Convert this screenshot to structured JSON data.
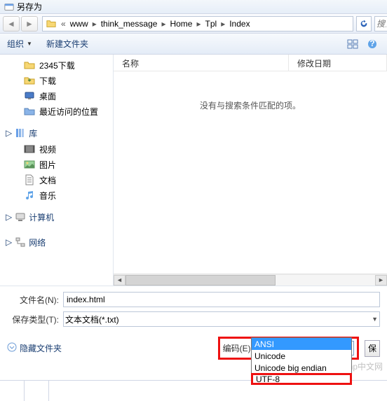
{
  "title": "另存为",
  "breadcrumb": [
    "www",
    "think_message",
    "Home",
    "Tpl",
    "Index"
  ],
  "search_placeholder": "搜索",
  "toolbar": {
    "organize": "组织",
    "new_folder": "新建文件夹"
  },
  "tree": {
    "recent": [
      {
        "label": "2345下载",
        "icon": "folder"
      },
      {
        "label": "下载",
        "icon": "download"
      },
      {
        "label": "桌面",
        "icon": "desktop"
      },
      {
        "label": "最近访问的位置",
        "icon": "recent"
      }
    ],
    "libraries_label": "库",
    "libraries": [
      {
        "label": "视频",
        "icon": "video"
      },
      {
        "label": "图片",
        "icon": "picture"
      },
      {
        "label": "文档",
        "icon": "document"
      },
      {
        "label": "音乐",
        "icon": "music"
      }
    ],
    "computer_label": "计算机",
    "network_label": "网络"
  },
  "list": {
    "col_name": "名称",
    "col_date": "修改日期",
    "empty": "没有与搜索条件匹配的项。"
  },
  "form": {
    "filename_label": "文件名(N):",
    "filename_value": "index.html",
    "type_label": "保存类型(T):",
    "type_value": "文本文档(*.txt)"
  },
  "bottom": {
    "hide_folders": "隐藏文件夹",
    "encoding_label": "编码(E):",
    "encoding_value": "ANSI",
    "save_btn": "保"
  },
  "dropdown": [
    "ANSI",
    "Unicode",
    "Unicode big endian",
    "UTF-8"
  ],
  "watermark": "php中文网"
}
